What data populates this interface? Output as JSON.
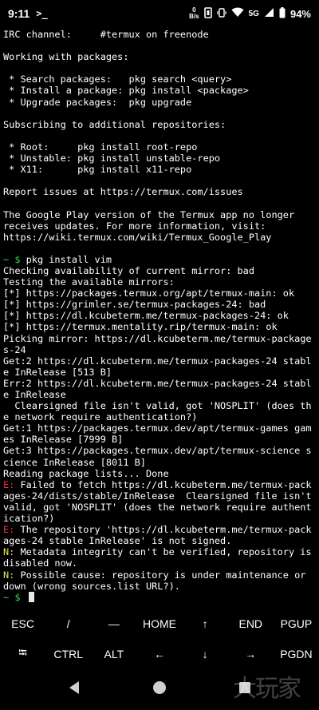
{
  "status": {
    "time": "9:11",
    "term_glyph": ">_",
    "net_rate_top": "0",
    "net_rate_bottom": "B/s",
    "network_type": "5G",
    "battery": "94%"
  },
  "terminal": {
    "lines": [
      {
        "text": "IRC channel:     #termux on freenode"
      },
      {
        "text": ""
      },
      {
        "text": "Working with packages:"
      },
      {
        "text": ""
      },
      {
        "text": " * Search packages:   pkg search <query>"
      },
      {
        "text": " * Install a package: pkg install <package>"
      },
      {
        "text": " * Upgrade packages:  pkg upgrade"
      },
      {
        "text": ""
      },
      {
        "text": "Subscribing to additional repositories:"
      },
      {
        "text": ""
      },
      {
        "text": " * Root:     pkg install root-repo"
      },
      {
        "text": " * Unstable: pkg install unstable-repo"
      },
      {
        "text": " * X11:      pkg install x11-repo"
      },
      {
        "text": ""
      },
      {
        "text": "Report issues at https://termux.com/issues"
      },
      {
        "text": ""
      },
      {
        "text": "The Google Play version of the Termux app no longer"
      },
      {
        "text": "receives updates. For more information, visit:"
      },
      {
        "text": "https://wiki.termux.com/wiki/Termux_Google_Play"
      },
      {
        "text": ""
      },
      {
        "prompt": "~ $",
        "text": " pkg install vim"
      },
      {
        "text": "Checking availability of current mirror: bad"
      },
      {
        "text": "Testing the available mirrors:"
      },
      {
        "text": "[*] https://packages.termux.org/apt/termux-main: ok"
      },
      {
        "text": "[*] https://grimler.se/termux-packages-24: bad"
      },
      {
        "text": "[*] https://dl.kcubeterm.me/termux-packages-24: ok"
      },
      {
        "text": "[*] https://termux.mentality.rip/termux-main: ok"
      },
      {
        "text": "Picking mirror: https://dl.kcubeterm.me/termux-packages-24"
      },
      {
        "text": "Get:2 https://dl.kcubeterm.me/termux-packages-24 stable InRelease [513 B]"
      },
      {
        "text": "Err:2 https://dl.kcubeterm.me/termux-packages-24 stable InRelease"
      },
      {
        "text": "  Clearsigned file isn't valid, got 'NOSPLIT' (does the network require authentication?)"
      },
      {
        "text": "Get:1 https://packages.termux.dev/apt/termux-games games InRelease [7999 B]"
      },
      {
        "text": "Get:3 https://packages.termux.dev/apt/termux-science science InRelease [8011 B]"
      },
      {
        "text": "Reading package lists... Done"
      },
      {
        "tag": "E:",
        "tag_class": "err",
        "text": " Failed to fetch https://dl.kcubeterm.me/termux-packages-24/dists/stable/InRelease  Clearsigned file isn't valid, got 'NOSPLIT' (does the network require authentication?)"
      },
      {
        "tag": "E:",
        "tag_class": "err",
        "text": " The repository 'https://dl.kcubeterm.me/termux-packages-24 stable InRelease' is not signed."
      },
      {
        "tag": "N:",
        "tag_class": "note",
        "text": " Metadata integrity can't be verified, repository is disabled now."
      },
      {
        "tag": "N:",
        "tag_class": "note",
        "text": " Possible cause: repository is under maintenance or down (wrong sources.list URL?)."
      },
      {
        "prompt": "~ $",
        "text": " ",
        "cursor": true
      }
    ]
  },
  "extra_keys": {
    "row1": [
      "ESC",
      "/",
      "—",
      "HOME",
      "↑",
      "END",
      "PGUP"
    ],
    "row2": [
      "⭾",
      "CTRL",
      "ALT",
      "←",
      "↓",
      "→",
      "PGDN"
    ]
  },
  "watermark": "大玩家",
  "colors": {
    "error": "#e6343a",
    "note": "#e2e05a",
    "prompt": "#3fd05a"
  }
}
